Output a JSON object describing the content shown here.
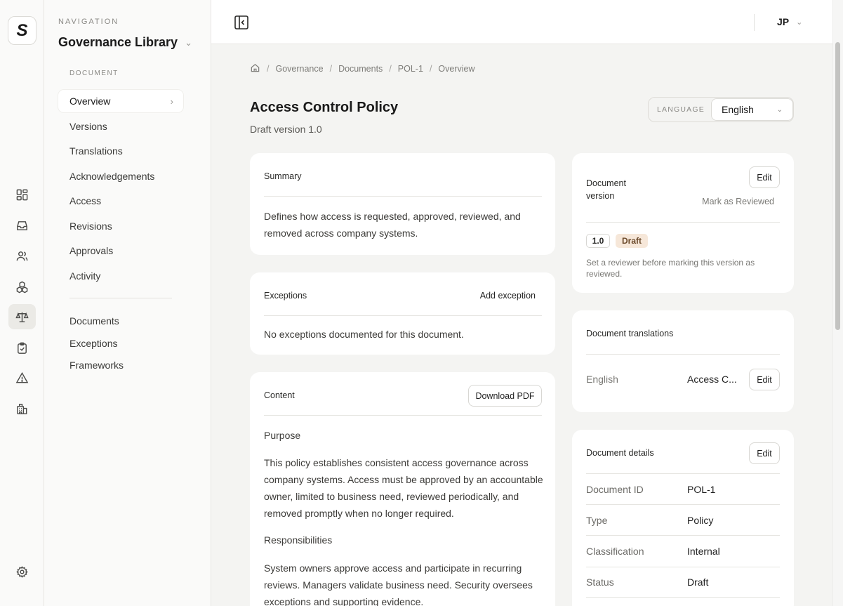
{
  "app": {
    "logo_letter": "S"
  },
  "rail": {
    "icons": [
      "dashboard-icon",
      "inbox-icon",
      "users-icon",
      "modules-icon",
      "scale-icon",
      "clipboard-check-icon",
      "warning-icon",
      "building-icon",
      "settings-icon"
    ],
    "active": "scale-icon"
  },
  "nav": {
    "caption": "NAVIGATION",
    "title": "Governance Library",
    "section": "DOCUMENT",
    "items": [
      "Overview",
      "Versions",
      "Translations",
      "Acknowledgements",
      "Access",
      "Revisions",
      "Approvals",
      "Activity"
    ],
    "active_item": "Overview",
    "secondary": [
      "Documents",
      "Exceptions",
      "Frameworks"
    ]
  },
  "topbar": {
    "user_initials": "JP"
  },
  "breadcrumb": [
    "Governance",
    "Documents",
    "POL-1",
    "Overview"
  ],
  "page": {
    "title": "Access Control Policy",
    "subtitle": "Draft version 1.0",
    "language_label": "LANGUAGE",
    "language_value": "English"
  },
  "summary": {
    "heading": "Summary",
    "text": "Defines how access is requested, approved, reviewed, and removed across company systems."
  },
  "exceptions": {
    "heading": "Exceptions",
    "action": "Add exception",
    "empty": "No exceptions documented for this document."
  },
  "content": {
    "heading": "Content",
    "action": "Download PDF",
    "purpose_heading": "Purpose",
    "purpose_text": "This policy establishes consistent access governance across company systems. Access must be approved by an accountable owner, limited to business need, reviewed periodically, and removed promptly when no longer required.",
    "resp_heading": "Responsibilities",
    "resp_text": "System owners approve access and participate in recurring reviews. Managers validate business need. Security oversees exceptions and supporting evidence."
  },
  "version_card": {
    "heading": "Document version",
    "edit": "Edit",
    "mark": "Mark as Reviewed",
    "version": "1.0",
    "status": "Draft",
    "note": "Set a reviewer before marking this version as reviewed."
  },
  "translations_card": {
    "heading": "Document translations",
    "language": "English",
    "title_trunc": "Access C...",
    "edit": "Edit"
  },
  "details_card": {
    "heading": "Document details",
    "edit": "Edit",
    "rows": [
      {
        "key": "Document ID",
        "value": "POL-1"
      },
      {
        "key": "Type",
        "value": "Policy"
      },
      {
        "key": "Classification",
        "value": "Internal"
      },
      {
        "key": "Status",
        "value": "Draft"
      }
    ]
  }
}
